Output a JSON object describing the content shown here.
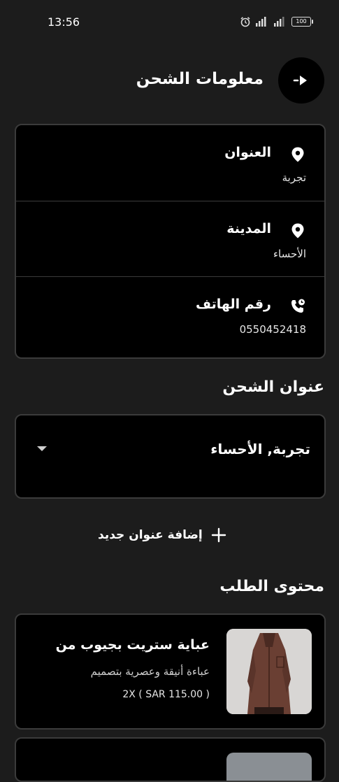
{
  "status_bar": {
    "time": "13:56",
    "battery": "100"
  },
  "header": {
    "title": "معلومات الشحن"
  },
  "info": {
    "address_label": "العنوان",
    "address_value": "تجربة",
    "city_label": "المدينة",
    "city_value": "الأحساء",
    "phone_label": "رقم الهاتف",
    "phone_value": "0550452418"
  },
  "shipping_address": {
    "title": "عنوان الشحن",
    "selected": "تجربة, الأحساء",
    "add_label": "إضافة عنوان جديد"
  },
  "order_contents": {
    "title": "محتوى الطلب",
    "items": [
      {
        "title": "عباية ستريت بجيوب من",
        "description": "عباءة أنيقة وعصرية بتصميم",
        "qty_price": "2X ( SAR 115.00 )"
      }
    ]
  },
  "colors": {
    "background": "#1c1c1c",
    "card": "#000000",
    "border": "#3b3b3b",
    "text": "#ffffff"
  }
}
